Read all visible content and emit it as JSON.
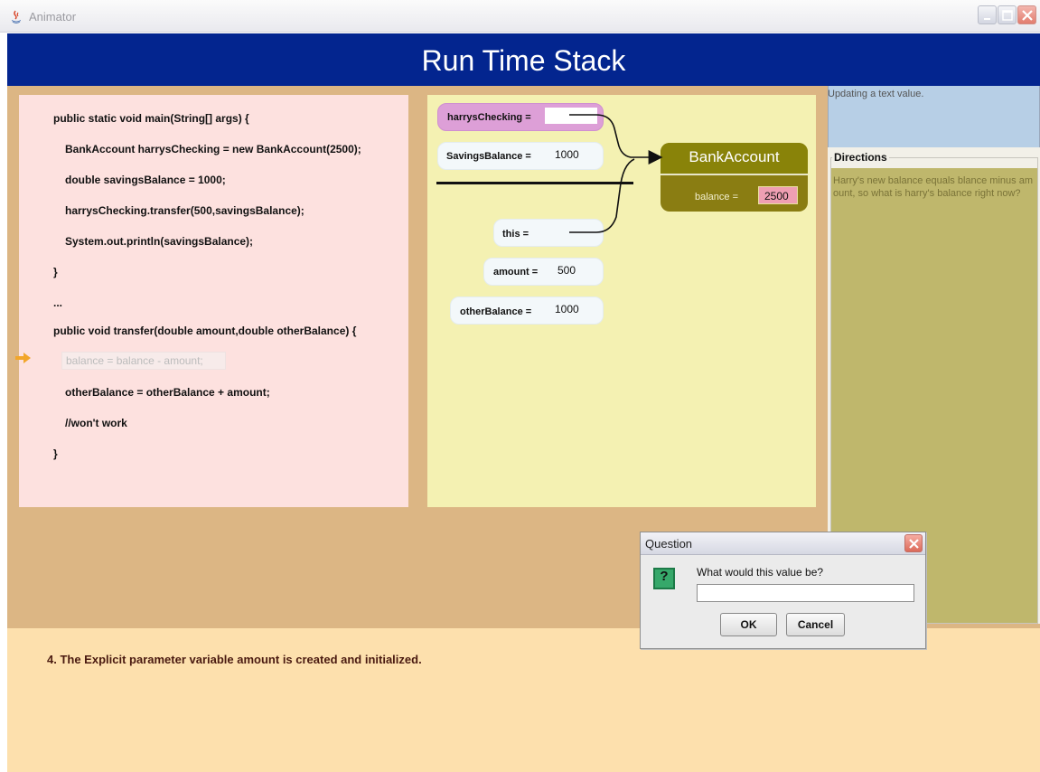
{
  "window": {
    "title": "Animator"
  },
  "banner": {
    "title": "Run Time Stack"
  },
  "code": {
    "lines": [
      "public static void main(String[] args) {",
      "BankAccount harrysChecking = new BankAccount(2500);",
      "double savingsBalance = 1000;",
      "harrysChecking.transfer(500,savingsBalance);",
      "System.out.println(savingsBalance);",
      "}",
      "...",
      "public void transfer(double amount,double otherBalance) {",
      "balance = balance - amount;",
      "otherBalance = otherBalance + amount;",
      "//won't work",
      "}"
    ],
    "current_line": "balance = balance - amount;"
  },
  "stack": {
    "main_frame": [
      {
        "label": "harrysChecking =",
        "value": ""
      },
      {
        "label": "SavingsBalance =",
        "value": "1000"
      }
    ],
    "transfer_frame": [
      {
        "label": "this =",
        "value": ""
      },
      {
        "label": "amount =",
        "value": "500"
      },
      {
        "label": "otherBalance =",
        "value": "1000"
      }
    ]
  },
  "heap_object": {
    "class_name": "BankAccount",
    "field_label": "balance =",
    "field_value": "2500"
  },
  "status": {
    "text": "Updating a text value."
  },
  "directions": {
    "legend": "Directions",
    "text": "Harry's new balance equals blance minus amount, so what is harry's balance right now?"
  },
  "explanation": {
    "text": "4. The Explicit parameter variable amount is created and initialized."
  },
  "dialog": {
    "title": "Question",
    "icon": "question-icon",
    "icon_glyph": "?",
    "prompt": "What would this value be?",
    "input_value": "",
    "ok_label": "OK",
    "cancel_label": "Cancel"
  },
  "colors": {
    "banner": "#03258f",
    "main_area": "#dcb684",
    "code_panel": "#fde1df",
    "stack_panel": "#f4f1b2",
    "object": "#898309",
    "directions": "#bfb76c",
    "highlight_ref": "#dd9fd7"
  }
}
